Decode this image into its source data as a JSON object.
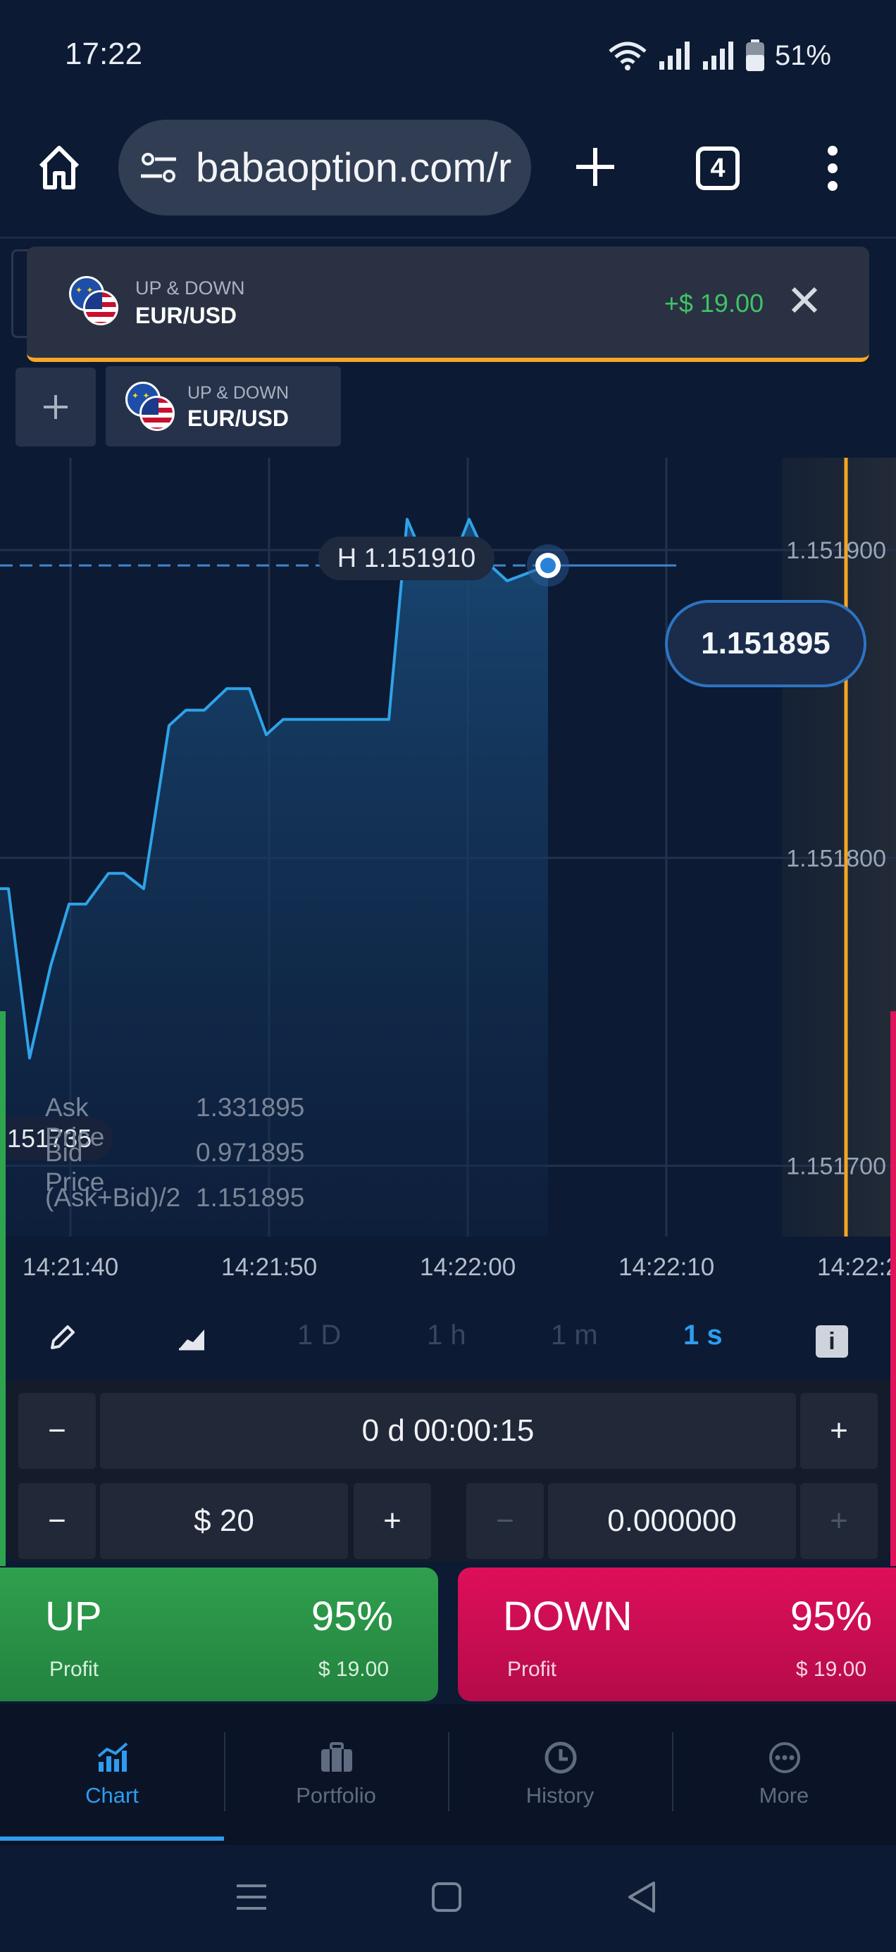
{
  "status_bar": {
    "time": "17:22",
    "battery": "51%"
  },
  "browser": {
    "url": "babaoption.com/r",
    "tab_count": "4"
  },
  "notification": {
    "kind": "UP & DOWN",
    "pair": "EUR/USD",
    "amount": "+$ 19.00"
  },
  "asset_tab": {
    "kind": "UP & DOWN",
    "pair": "EUR/USD"
  },
  "chart": {
    "high_label": "H 1.151910",
    "current_price": "1.151895",
    "low_label": "151735",
    "price_axis": [
      "1.151900",
      "1.151800",
      "1.151700"
    ],
    "price_info": [
      {
        "label": "Ask Price",
        "value": "1.331895"
      },
      {
        "label": "Bid Price",
        "value": "0.971895"
      },
      {
        "label": "(Ask+Bid)/2",
        "value": "1.151895"
      }
    ],
    "time_axis": [
      "14:21:40",
      "14:21:50",
      "14:22:00",
      "14:22:10",
      "14:22:2"
    ]
  },
  "chart_data": {
    "type": "area",
    "title": "",
    "xlabel": "",
    "ylabel": "",
    "ylim": [
      1.151677,
      1.15193
    ],
    "x": [
      "14:21:40",
      "",
      "",
      "",
      "",
      "",
      "",
      "",
      "",
      "",
      "",
      "",
      "",
      "",
      "",
      "",
      "",
      "",
      "",
      "",
      "",
      "",
      "14:22:00",
      "",
      "",
      "",
      "",
      "",
      ""
    ],
    "values": [
      1.15179,
      1.151735,
      1.151765,
      1.151785,
      1.151785,
      1.151795,
      1.151795,
      1.15179,
      1.151843,
      1.151848,
      1.151848,
      1.151855,
      1.151855,
      1.15184,
      1.151845,
      1.151845,
      1.151845,
      1.15191,
      1.151895,
      1.151895,
      1.15191,
      1.151895,
      1.15189,
      1.151895
    ],
    "series": [
      {
        "values": [
          1.15179,
          1.151735,
          1.151765,
          1.151785,
          1.151785,
          1.151795,
          1.151795,
          1.15179,
          1.151843,
          1.151848,
          1.151848,
          1.151855,
          1.151855,
          1.15184,
          1.151845,
          1.151845,
          1.151845,
          1.15191,
          1.151895,
          1.151895,
          1.15191,
          1.151895,
          1.15189,
          1.151895
        ]
      }
    ],
    "grid": true,
    "colors": {
      "line": "#2ea3e8",
      "fill": "#1a4c7a",
      "expiry": "#f5a623"
    }
  },
  "toolbar": {
    "timeframes": [
      "1 D",
      "1 h",
      "1 m",
      "1 s"
    ],
    "active": "1 s",
    "info": "i"
  },
  "trade": {
    "duration": "0 d 00:00:15",
    "amount": "$ 20",
    "rate": "0.000000",
    "minus": "−",
    "plus": "+"
  },
  "up": {
    "label": "UP",
    "percent": "95%",
    "profit_label": "Profit",
    "profit": "$ 19.00"
  },
  "down": {
    "label": "DOWN",
    "percent": "95%",
    "profit_label": "Profit",
    "profit": "$ 19.00"
  },
  "nav": [
    {
      "label": "Chart",
      "icon": "chart-icon"
    },
    {
      "label": "Portfolio",
      "icon": "briefcase-icon"
    },
    {
      "label": "History",
      "icon": "clock-icon"
    },
    {
      "label": "More",
      "icon": "more-icon"
    }
  ],
  "colors": {
    "background": "#0c1a33",
    "accent": "#2e9cf0",
    "up": "#2fa04d",
    "down": "#de0f5a",
    "profit_text": "#3ec466"
  }
}
